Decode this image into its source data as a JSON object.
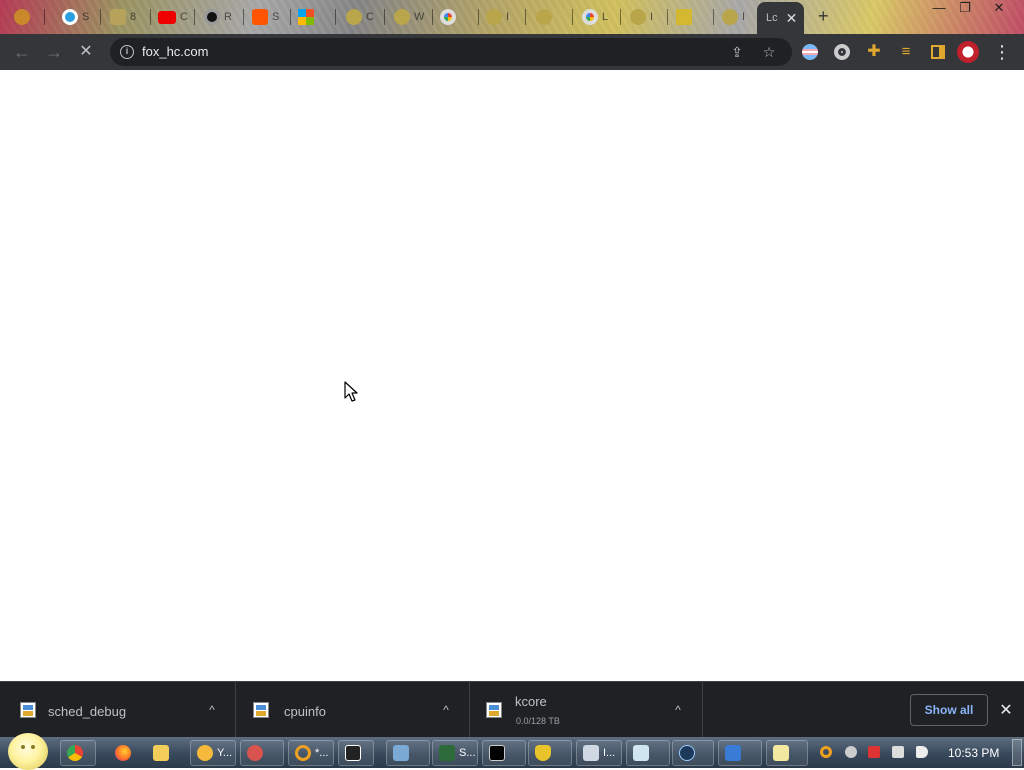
{
  "browser": {
    "tabs": [
      {
        "label": "S"
      },
      {
        "label": "8"
      },
      {
        "label": "C"
      },
      {
        "label": "R"
      },
      {
        "label": "S"
      },
      {
        "label": "C"
      },
      {
        "label": "W"
      },
      {
        "label": "I"
      },
      {
        "label": "L"
      },
      {
        "label": "I"
      },
      {
        "label": "I"
      }
    ],
    "active_tab": {
      "label": "Lc",
      "close": "✕"
    },
    "new_tab": "+",
    "window_controls": {
      "minimize": "—",
      "restore": "❐",
      "close": "✕"
    },
    "toolbar": {
      "back": "←",
      "forward": "→",
      "stop": "✕",
      "url": "fox_hc.com",
      "info_icon": "i",
      "share_icon": "⇪",
      "bookmark_icon": "☆",
      "menu": "⋮"
    }
  },
  "downloads": {
    "items": [
      {
        "name": "sched_debug",
        "sub": ""
      },
      {
        "name": "cpuinfo",
        "sub": ""
      },
      {
        "name": "kcore",
        "sub": "0.0/128 TB"
      }
    ],
    "chevron": "^",
    "show_all": "Show all",
    "close": "✕"
  },
  "taskbar": {
    "items": [
      {
        "label": "Y..."
      },
      {
        "label": "*..."
      },
      {
        "label": "S..."
      },
      {
        "label": "I..."
      }
    ],
    "clock": "10:53 PM"
  },
  "colors": {
    "toolbar_bg": "#35363a",
    "omnibox_bg": "#202124",
    "shelf_bg": "#202124",
    "show_all_text": "#8ab4f8"
  }
}
